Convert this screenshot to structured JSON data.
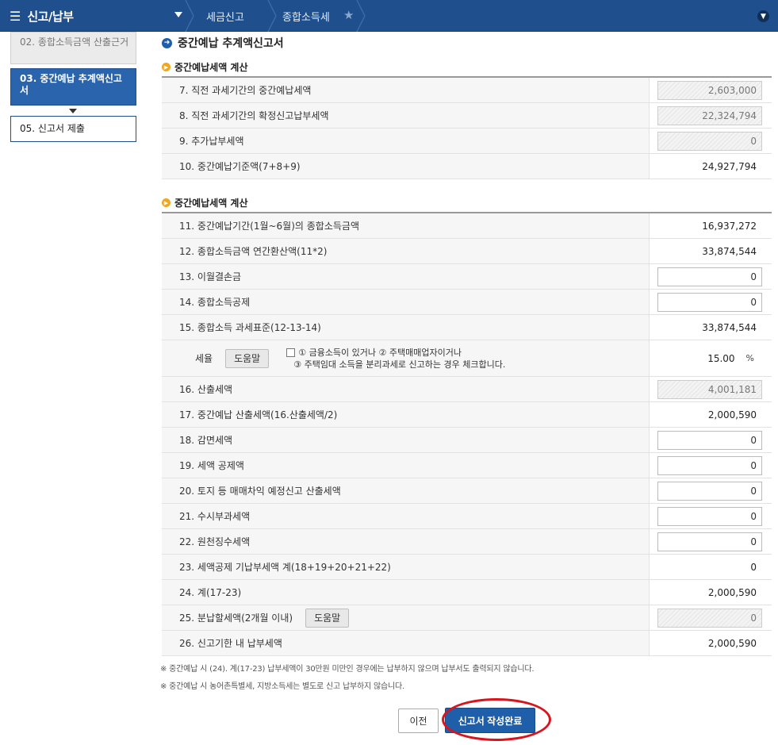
{
  "topbar": {
    "menu_icon": "hamburger-icon",
    "menu_title": "신고/납부",
    "crumbs": [
      "세금신고",
      "종합소득세"
    ],
    "star_icon": "star-icon",
    "expand_icon": "chevron-down-icon"
  },
  "sidebar": {
    "items": [
      {
        "label": "02. 종합소득금액 산출근거",
        "state": "inactive"
      },
      {
        "label": "03. 중간예납 추계액신고서",
        "state": "active"
      },
      {
        "label": "05. 신고서 제출",
        "state": "normal"
      }
    ]
  },
  "page": {
    "title": "중간예납 추계액신고서"
  },
  "section1": {
    "title": "중간예납세액 계산",
    "rows": [
      {
        "label": "7. 직전 과세기간의 중간예납세액",
        "value": "2,603,000",
        "kind": "readonly"
      },
      {
        "label": "8. 직전 과세기간의 확정신고납부세액",
        "value": "22,324,794",
        "kind": "readonly"
      },
      {
        "label": "9. 추가납부세액",
        "value": "0",
        "kind": "readonly"
      },
      {
        "label": "10. 중간예납기준액(7+8+9)",
        "value": "24,927,794",
        "kind": "text"
      }
    ]
  },
  "section2": {
    "title": "중간예납세액 계산",
    "rows": [
      {
        "label": "11. 중간예납기간(1월~6월)의 종합소득금액",
        "value": "16,937,272",
        "kind": "text"
      },
      {
        "label": "12. 종합소득금액 연간환산액(11*2)",
        "value": "33,874,544",
        "kind": "text"
      },
      {
        "label": "13. 이월결손금",
        "value": "0",
        "kind": "input"
      },
      {
        "label": "14. 종합소득공제",
        "value": "0",
        "kind": "input"
      },
      {
        "label": "15. 종합소득 과세표준(12-13-14)",
        "value": "33,874,544",
        "kind": "text"
      }
    ],
    "rate": {
      "label": "세율",
      "help": "도움말",
      "check_line1": "① 금융소득이 있거나 ② 주택매매업자이거나",
      "check_line2": "③ 주택임대 소득을 분리과세로 신고하는 경우 체크합니다.",
      "value": "15.00",
      "unit": "%"
    },
    "rows2": [
      {
        "label": "16. 산출세액",
        "value": "4,001,181",
        "kind": "readonly"
      },
      {
        "label": "17. 중간예납 산출세액(16.산출세액/2)",
        "value": "2,000,590",
        "kind": "text"
      },
      {
        "label": "18. 감면세액",
        "value": "0",
        "kind": "input"
      },
      {
        "label": "19. 세액 공제액",
        "value": "0",
        "kind": "input"
      },
      {
        "label": "20. 토지 등 매매차익 예정신고 산출세액",
        "value": "0",
        "kind": "input"
      },
      {
        "label": "21. 수시부과세액",
        "value": "0",
        "kind": "input"
      },
      {
        "label": "22. 원천징수세액",
        "value": "0",
        "kind": "input"
      },
      {
        "label": "23. 세액공제 기납부세액 계(18+19+20+21+22)",
        "value": "0",
        "kind": "text"
      },
      {
        "label": "24. 계(17-23)",
        "value": "2,000,590",
        "kind": "text"
      }
    ],
    "row25": {
      "label": "25. 분납할세액(2개월 이내)",
      "help": "도움말",
      "value": "0"
    },
    "row26": {
      "label": "26. 신고기한 내 납부세액",
      "value": "2,000,590"
    }
  },
  "notes": [
    "※ 중간예납 시 (24). 계(17-23) 납부세액이 30만원 미만인 경우에는 납부하지 않으며 납부서도 출력되지 않습니다.",
    "※ 중간예납 시 농어촌특별세, 지방소득세는 별도로 신고 납부하지 않습니다."
  ],
  "buttons": {
    "prev": "이전",
    "done": "신고서 작성완료"
  },
  "colors": {
    "brand": "#1f4f8d",
    "accent": "#1f5ea8",
    "highlight": "#d9141c"
  }
}
